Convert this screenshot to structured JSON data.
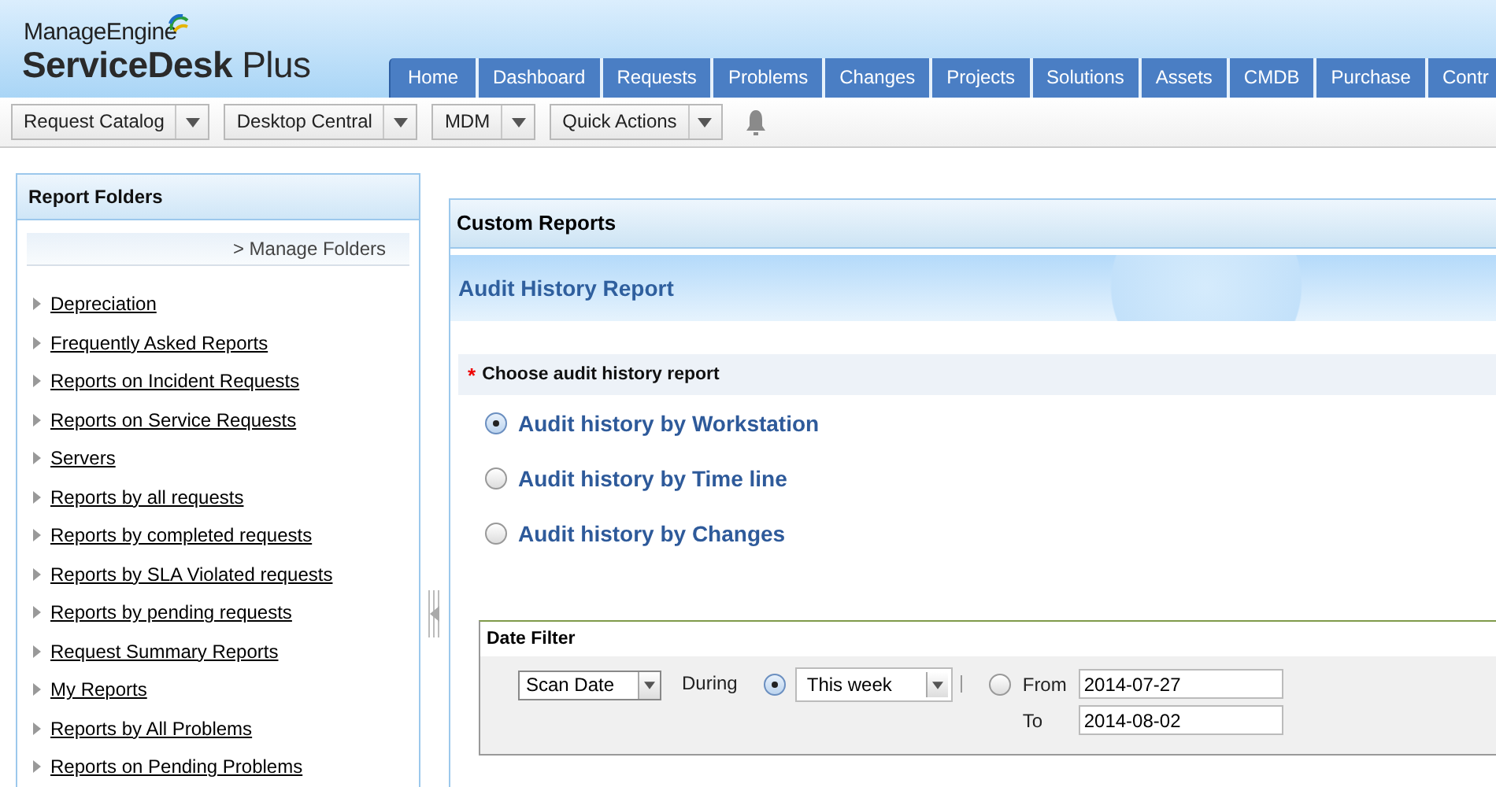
{
  "header": {
    "brand_top": "ManageEngine",
    "brand_bottom_bold": "ServiceDesk",
    "brand_bottom_light": "Plus"
  },
  "tabs": [
    {
      "label": "Home"
    },
    {
      "label": "Dashboard"
    },
    {
      "label": "Requests"
    },
    {
      "label": "Problems"
    },
    {
      "label": "Changes"
    },
    {
      "label": "Projects"
    },
    {
      "label": "Solutions"
    },
    {
      "label": "Assets"
    },
    {
      "label": "CMDB"
    },
    {
      "label": "Purchase"
    },
    {
      "label": "Contr"
    }
  ],
  "toolbar": [
    {
      "label": "Request Catalog"
    },
    {
      "label": "Desktop Central"
    },
    {
      "label": "MDM"
    },
    {
      "label": "Quick Actions"
    }
  ],
  "sidebar": {
    "title": "Report Folders",
    "manage_link": "> Manage Folders",
    "items": [
      {
        "label": "Depreciation"
      },
      {
        "label": "Frequently Asked Reports"
      },
      {
        "label": "Reports on Incident Requests"
      },
      {
        "label": "Reports on Service Requests"
      },
      {
        "label": "Servers"
      },
      {
        "label": "Reports by all requests"
      },
      {
        "label": "Reports by completed requests"
      },
      {
        "label": "Reports by SLA Violated requests"
      },
      {
        "label": "Reports by pending requests"
      },
      {
        "label": "Request Summary Reports"
      },
      {
        "label": "My Reports"
      },
      {
        "label": "Reports by All Problems"
      },
      {
        "label": "Reports on Pending Problems"
      }
    ]
  },
  "main": {
    "panel_title": "Custom Reports",
    "report_title": "Audit History Report",
    "required_mark": "*",
    "choose_label": "Choose audit history report",
    "options": [
      {
        "label": "Audit history by Workstation",
        "selected": true
      },
      {
        "label": "Audit history by Time line",
        "selected": false
      },
      {
        "label": "Audit history by Changes",
        "selected": false
      }
    ],
    "date_filter": {
      "title": "Date Filter",
      "date_field": "Scan Date",
      "during_label": "During",
      "during_selected": true,
      "period": "This week",
      "range_selected": false,
      "from_label": "From",
      "from_value": "2014-07-27",
      "to_label": "To",
      "to_value": "2014-08-02"
    }
  }
}
